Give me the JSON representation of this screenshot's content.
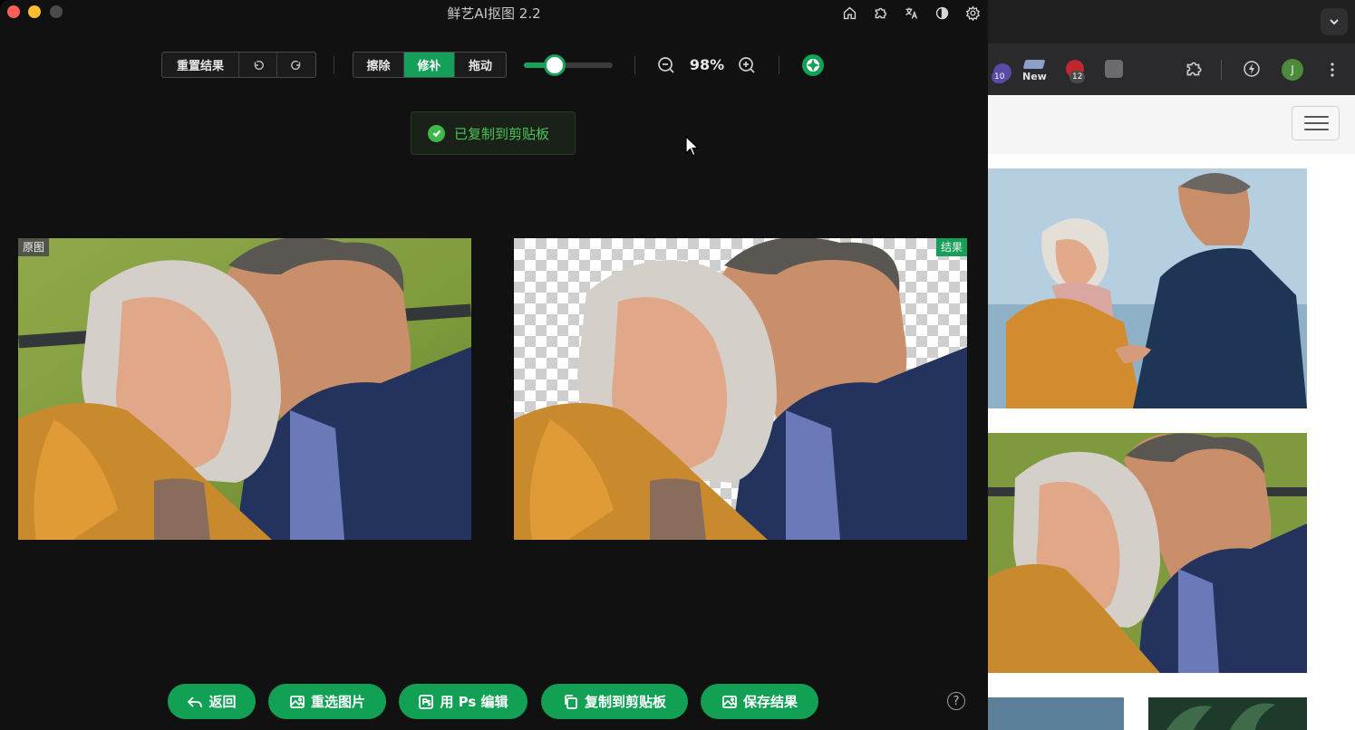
{
  "app": {
    "title": "鲜艺AI抠图 2.2",
    "title_icons": [
      "home-icon",
      "puzzle-icon",
      "translate-icon",
      "theme-icon",
      "settings-icon"
    ]
  },
  "toolbar": {
    "reset_label": "重置结果",
    "undo_icon": "undo-icon",
    "redo_icon": "redo-icon",
    "modes": [
      "擦除",
      "修补",
      "拖动"
    ],
    "active_mode": "修补",
    "brush_size_fraction": 0.35,
    "zoom_text": "98%"
  },
  "toast": {
    "text": "已复制到剪贴板"
  },
  "panels": {
    "original_tag": "原图",
    "result_tag": "结果"
  },
  "actions": {
    "back": "返回",
    "reselect": "重选图片",
    "ps_edit": "用 Ps 编辑",
    "copy": "复制到剪贴板",
    "save": "保存结果",
    "help": "?"
  },
  "browser": {
    "ext_badge_1": "10",
    "ext_new": "New",
    "ext_badge_2": "12",
    "profile_initial": "J"
  },
  "colors": {
    "accent": "#14a058",
    "toast_text": "#4bc456",
    "app_bg": "#111112"
  }
}
